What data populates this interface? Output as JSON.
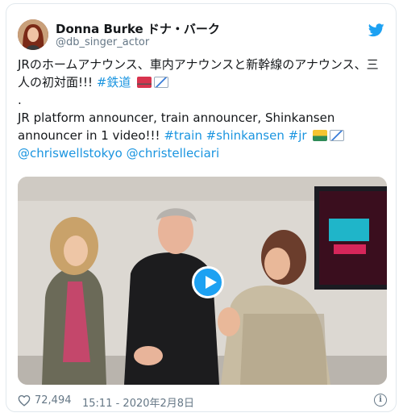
{
  "author": {
    "display_name": "Donna Burke ドナ・バーク",
    "handle": "@db_singer_actor"
  },
  "tweet": {
    "line1_text": "JRのホームアナウンス、車内アナウンスと新幹線のアナウンス、三人の初対面!!! ",
    "line1_tag": "#鉄道",
    "dot": ".",
    "line2_text": "JR platform announcer, train announcer, Shinkansen announcer in 1 video!!! ",
    "tag_train": "#train",
    "tag_shinkansen": "#shinkansen",
    "tag_jr": "#jr",
    "mention1": "@chriswellstokyo",
    "mention2": "@christelleciari"
  },
  "footer": {
    "likes": "72,494",
    "timestamp": "15:11 - 2020年2月8日",
    "info_icon": "i"
  },
  "icons": {
    "logo": "twitter-bird",
    "like": "heart",
    "info": "info-circle",
    "play": "play"
  },
  "colors": {
    "link": "#1b95e0",
    "twitter_blue": "#1da1f2",
    "secondary_text": "#657786"
  }
}
